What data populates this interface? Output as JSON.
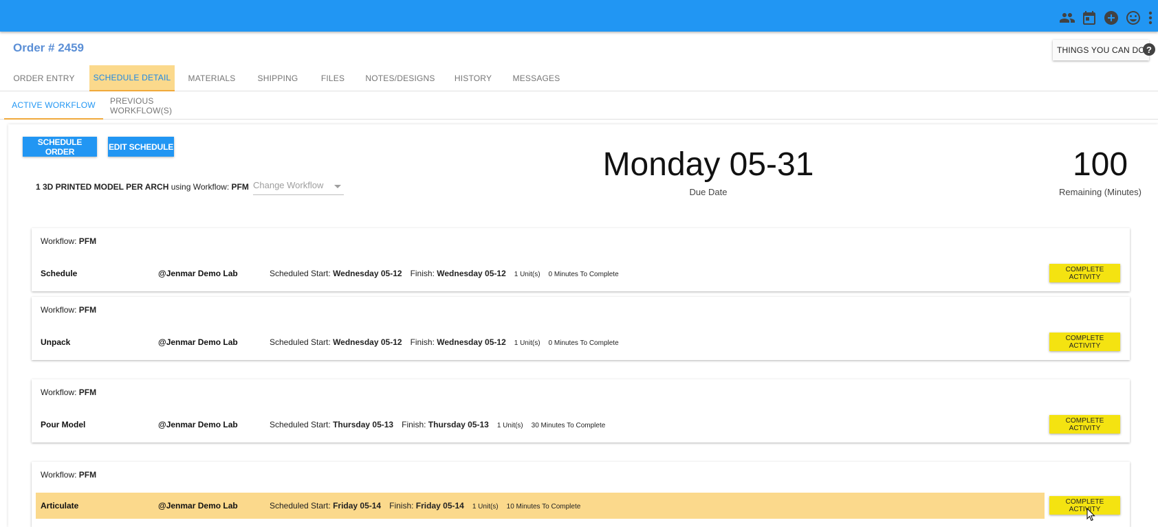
{
  "header": {
    "icons": [
      "people-icon",
      "calendar-icon",
      "add-circle-icon",
      "smiley-icon",
      "more-vert-icon"
    ]
  },
  "order": {
    "title": "Order # 2459"
  },
  "things_button": "THINGS YOU CAN DO",
  "help": "?",
  "main_tabs": [
    {
      "label": "ORDER ENTRY"
    },
    {
      "label": "SCHEDULE DETAIL",
      "active": true
    },
    {
      "label": "MATERIALS"
    },
    {
      "label": "SHIPPING"
    },
    {
      "label": "FILES"
    },
    {
      "label": "NOTES/DESIGNS"
    },
    {
      "label": "HISTORY"
    },
    {
      "label": "MESSAGES"
    }
  ],
  "sub_tabs": [
    {
      "label": "ACTIVE WORKFLOW",
      "active": true
    },
    {
      "label": "PREVIOUS WORKFLOW(S)"
    }
  ],
  "actions": {
    "schedule_order": "SCHEDULE ORDER",
    "edit_schedule": "EDIT SCHEDULE"
  },
  "product": {
    "name": "1 3D PRINTED MODEL PER ARCH",
    "using": " using Workflow: ",
    "workflow": "PFM",
    "change_placeholder": "Change Workflow"
  },
  "due": {
    "value": "Monday 05-31",
    "label": "Due Date"
  },
  "remaining": {
    "value": "100",
    "label": "Remaining (Minutes)"
  },
  "workflow_label": "Workflow: ",
  "labels": {
    "scheduled_start": "Scheduled Start: ",
    "finish": "Finish: ",
    "complete": "COMPLETE ACTIVITY"
  },
  "activities": [
    {
      "workflow": "PFM",
      "name": "Schedule",
      "lab": "@Jenmar Demo Lab",
      "start": "Wednesday 05-12",
      "finish": "Wednesday 05-12",
      "units": "1 Unit(s)",
      "minutes": "0 Minutes To Complete"
    },
    {
      "workflow": "PFM",
      "name": "Unpack",
      "lab": "@Jenmar Demo Lab",
      "start": "Wednesday 05-12",
      "finish": "Wednesday 05-12",
      "units": "1 Unit(s)",
      "minutes": "0 Minutes To Complete"
    },
    {
      "workflow": "PFM",
      "name": "Pour Model",
      "lab": "@Jenmar Demo Lab",
      "start": "Thursday 05-13",
      "finish": "Thursday 05-13",
      "units": "1 Unit(s)",
      "minutes": "30 Minutes To Complete"
    },
    {
      "workflow": "PFM",
      "name": "Articulate",
      "lab": "@Jenmar Demo Lab",
      "start": "Friday 05-14",
      "finish": "Friday 05-14",
      "units": "1 Unit(s)",
      "minutes": "10 Minutes To Complete",
      "highlighted": true
    }
  ],
  "colors": {
    "topbar": "#2196f3",
    "active_tab_bg": "#fbd98c",
    "accent": "#f0a93b",
    "complete_btn": "#f4e311",
    "title_blue": "#5b8fd6"
  }
}
